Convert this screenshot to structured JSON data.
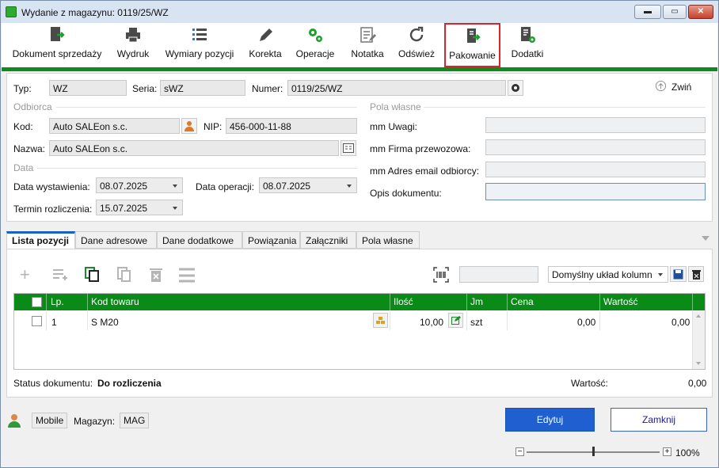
{
  "window": {
    "title": "Wydanie z magazynu: 0119/25/WZ",
    "min": "▬",
    "max": "▭",
    "close": "✕"
  },
  "toolbar": [
    {
      "label": "Dokument sprzedaży",
      "icon": "document-arrow-icon"
    },
    {
      "label": "Wydruk",
      "icon": "printer-icon"
    },
    {
      "label": "Wymiary pozycji",
      "icon": "list-icon"
    },
    {
      "label": "Korekta",
      "icon": "pencil-icon"
    },
    {
      "label": "Operacje",
      "icon": "gears-icon"
    },
    {
      "label": "Notatka",
      "icon": "note-icon"
    },
    {
      "label": "Odśwież",
      "icon": "refresh-icon"
    },
    {
      "label": "Pakowanie",
      "icon": "package-icon"
    },
    {
      "label": "Dodatki",
      "icon": "addons-icon"
    }
  ],
  "header": {
    "typ_label": "Typ:",
    "typ": "WZ",
    "seria_label": "Seria:",
    "seria": "sWZ",
    "numer_label": "Numer:",
    "numer": "0119/25/WZ",
    "collapse": "Zwiń"
  },
  "odbiorca": {
    "group": "Odbiorca",
    "kod_label": "Kod:",
    "kod": "Auto SALEon s.c.",
    "nip_label": "NIP:",
    "nip": "456-000-11-88",
    "nazwa_label": "Nazwa:",
    "nazwa": "Auto SALEon s.c."
  },
  "data": {
    "group": "Data",
    "wystawienia_label": "Data wystawienia:",
    "wystawienia": "08.07.2025",
    "operacji_label": "Data operacji:",
    "operacji": "08.07.2025",
    "termin_label": "Termin rozliczenia:",
    "termin": "15.07.2025"
  },
  "pola": {
    "group": "Pola własne",
    "uwagi_label": "mm Uwagi:",
    "uwagi": "",
    "firma_label": "mm Firma przewozowa:",
    "firma": "",
    "email_label": "mm Adres email odbiorcy:",
    "email": "",
    "opis_label": "Opis dokumentu:",
    "opis": ""
  },
  "tabs": [
    "Lista pozycji",
    "Dane adresowe",
    "Dane dodatkowe",
    "Powiązania",
    "Załączniki",
    "Pola własne"
  ],
  "grid_tools": {
    "layout": "Domyślny układ kolumn",
    "search": ""
  },
  "grid": {
    "columns": [
      "Lp.",
      "Kod towaru",
      "Ilość",
      "Jm",
      "Cena",
      "Wartość"
    ],
    "rows": [
      {
        "lp": "1",
        "kod": "S M20",
        "ilosc": "10,00",
        "jm": "szt",
        "cena": "0,00",
        "wartosc": "0,00"
      }
    ]
  },
  "status": {
    "label": "Status dokumentu:",
    "value": "Do rozliczenia",
    "wartosc_label": "Wartość:",
    "wartosc": "0,00"
  },
  "footer": {
    "mobile": "Mobile",
    "magazyn_label": "Magazyn:",
    "magazyn": "MAG",
    "edit": "Edytuj",
    "close": "Zamknij",
    "zoom": "100%",
    "zoom_value": 0.5
  },
  "colors": {
    "accent": "#0f8a1f",
    "primary_button": "#1f5fd0",
    "highlight": "#d8262a"
  }
}
